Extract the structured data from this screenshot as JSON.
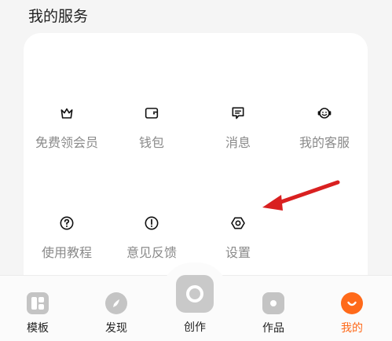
{
  "section": {
    "title": "我的服务"
  },
  "services": [
    {
      "label": "免费领会员",
      "icon": "crown-icon"
    },
    {
      "label": "钱包",
      "icon": "wallet-icon"
    },
    {
      "label": "消息",
      "icon": "message-icon"
    },
    {
      "label": "我的客服",
      "icon": "headset-icon"
    },
    {
      "label": "使用教程",
      "icon": "help-circle-icon"
    },
    {
      "label": "意见反馈",
      "icon": "exclamation-circle-icon"
    },
    {
      "label": "设置",
      "icon": "gear-hexagon-icon"
    }
  ],
  "tabs": [
    {
      "label": "模板",
      "icon": "template-icon"
    },
    {
      "label": "发现",
      "icon": "compass-icon"
    },
    {
      "label": "创作",
      "icon": "create-icon"
    },
    {
      "label": "作品",
      "icon": "video-play-icon"
    },
    {
      "label": "我的",
      "icon": "profile-smile-icon",
      "active": true
    }
  ],
  "colors": {
    "accent": "#ff6a1a",
    "annotation_arrow": "#d92020",
    "icon_gray": "#c4c4c4"
  }
}
